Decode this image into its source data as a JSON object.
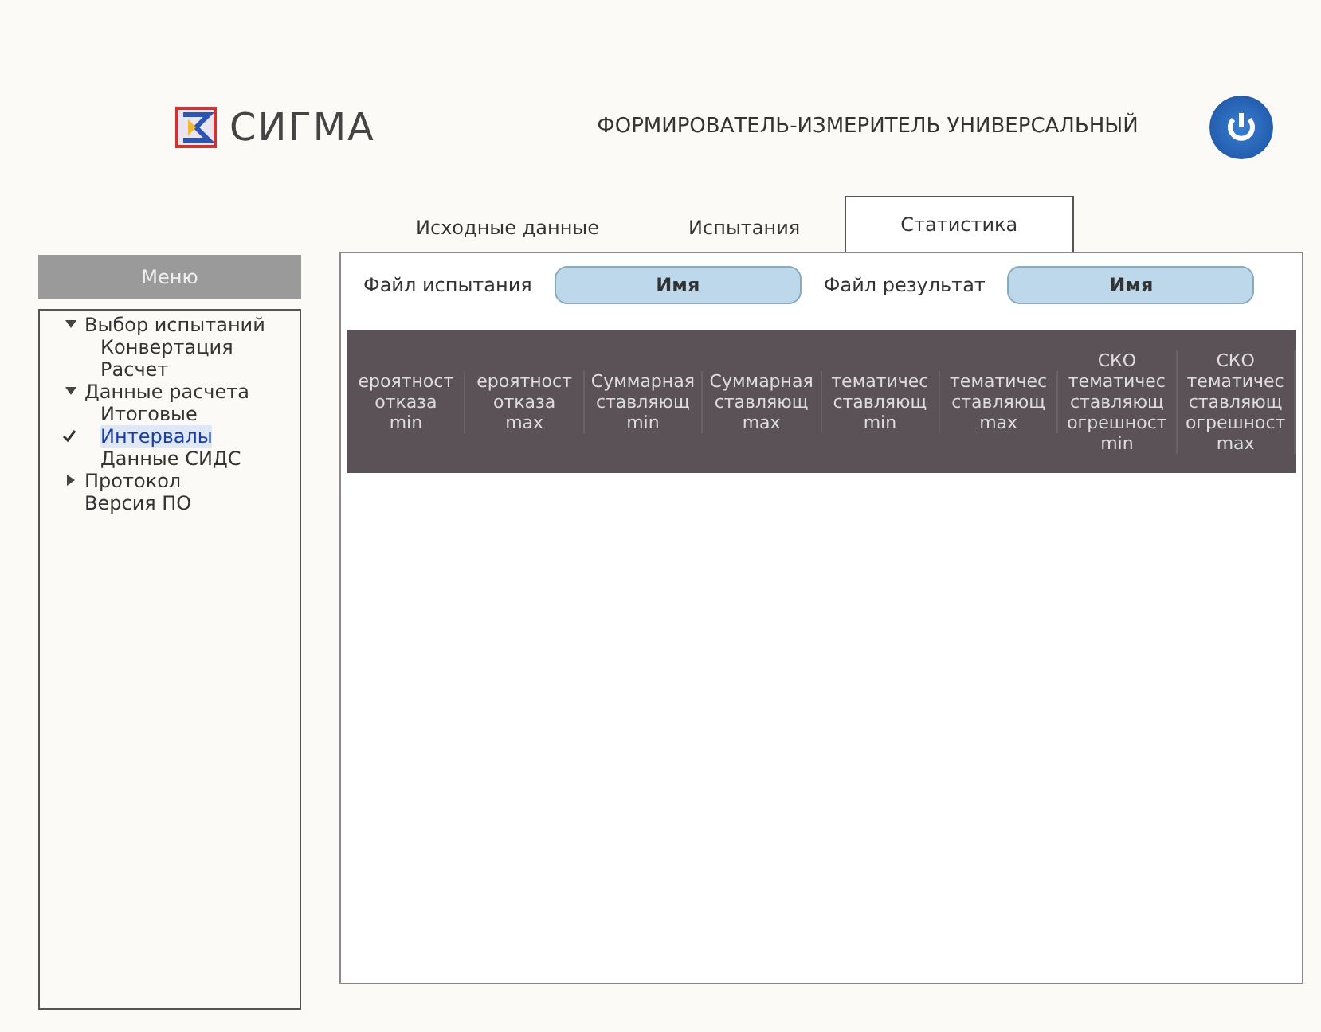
{
  "header": {
    "logo": "СИГМА",
    "title": "ФОРМИРОВАТЕЛЬ-ИЗМЕРИТЕЛЬ УНИВЕРСАЛЬНЫЙ"
  },
  "menu": {
    "title": "Меню",
    "items": [
      {
        "label": "Выбор испытаний",
        "expanded": true,
        "selected": false,
        "children": [
          {
            "label": "Конвертация",
            "selected": false
          },
          {
            "label": "Расчет",
            "selected": false
          }
        ]
      },
      {
        "label": "Данные расчета",
        "expanded": true,
        "selected": false,
        "children": [
          {
            "label": "Итоговые",
            "selected": false
          },
          {
            "label": "Интервалы",
            "selected": true
          },
          {
            "label": "Данные СИДС",
            "selected": false
          }
        ]
      },
      {
        "label": "Протокол",
        "expanded": false,
        "selected": false
      },
      {
        "label": "Версия ПО",
        "selected": false
      }
    ]
  },
  "tabs": [
    {
      "label": "Исходные данные",
      "selected": false
    },
    {
      "label": "Испытания",
      "selected": false
    },
    {
      "label": "Статистика",
      "selected": true
    }
  ],
  "files": [
    {
      "label": "Файл испытания",
      "value": "Имя"
    },
    {
      "label": "Файл результат",
      "value": "Имя"
    }
  ],
  "table": {
    "columns": [
      [
        "ероятност",
        "отказа",
        "min"
      ],
      [
        "ероятност",
        "отказа",
        "max"
      ],
      [
        "Суммарная",
        "ставляющ",
        "min"
      ],
      [
        "Суммарная",
        "ставляющ",
        "max"
      ],
      [
        "тематичес",
        "ставляющ",
        "min"
      ],
      [
        "тематичес",
        "ставляющ",
        "max"
      ],
      [
        "СКО",
        "тематичес",
        "ставляющ",
        "огрешност",
        "min"
      ],
      [
        "СКО",
        "тематичес",
        "ставляющ",
        "огрешност",
        "max"
      ]
    ]
  }
}
